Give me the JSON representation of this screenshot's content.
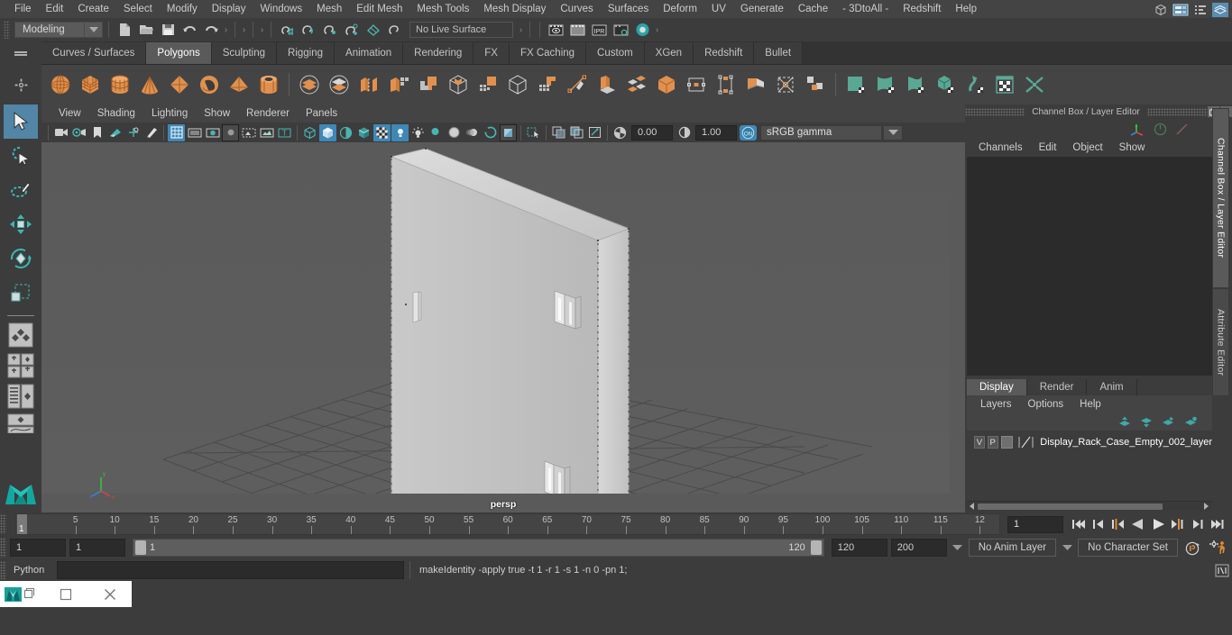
{
  "app": {
    "title": "Autodesk Maya",
    "menubar": [
      "File",
      "Edit",
      "Create",
      "Select",
      "Modify",
      "Display",
      "Windows",
      "Mesh",
      "Edit Mesh",
      "Mesh Tools",
      "Mesh Display",
      "Curves",
      "Surfaces",
      "Deform",
      "UV",
      "Generate",
      "Cache",
      "- 3DtoAll -",
      "Redshift",
      "Help"
    ]
  },
  "status_line": {
    "menu_set": "Modeling",
    "live_surface": "No Live Surface",
    "icons": [
      "new-scene-icon",
      "open-scene-icon",
      "save-scene-icon",
      "undo-icon",
      "redo-icon",
      "select-by-hierarchy-icon",
      "select-by-object-icon",
      "select-by-component-icon",
      "snap-to-grid-icon",
      "snap-to-curve-icon",
      "snap-to-point-icon",
      "snap-to-projected-center-icon",
      "snap-to-view-plane-icon",
      "make-live-icon",
      "render-current-frame-icon",
      "ipr-render-icon",
      "render-settings-icon",
      "hypershade-icon"
    ],
    "right_icons": [
      "show-hide-modeling-toolkit-icon",
      "show-hide-attribute-editor-icon",
      "show-hide-tool-settings-icon",
      "show-hide-channel-box-icon"
    ]
  },
  "shelf": {
    "tabs": [
      "Curves / Surfaces",
      "Polygons",
      "Sculpting",
      "Rigging",
      "Animation",
      "Rendering",
      "FX",
      "FX Caching",
      "Custom",
      "XGen",
      "Redshift",
      "Bullet"
    ],
    "active_tab": "Polygons",
    "icons": [
      "poly-sphere",
      "poly-cube",
      "poly-cylinder",
      "poly-cone",
      "poly-octahedron",
      "poly-torus",
      "poly-pyramid",
      "poly-pipe",
      "combine",
      "separate",
      "extract",
      "booleans-union",
      "booleans-difference",
      "smooth",
      "add-divisions",
      "create-polygon-tool",
      "extrude",
      "bevel",
      "bridge",
      "append-to-polygon",
      "wedge",
      "poke-face",
      "connect-components",
      "multi-cut",
      "target-weld",
      "quad-draw",
      "uv-planar",
      "uv-cylindrical",
      "uv-spherical",
      "uv-automatic",
      "uv-editor",
      "unfold-uv"
    ]
  },
  "toolbox": {
    "tools": [
      "select-tool",
      "lasso-select-tool",
      "paint-select-tool",
      "move-tool",
      "rotate-tool",
      "scale-tool",
      "last-tool-used"
    ],
    "active": "select-tool",
    "layouts": [
      "single-perspective-view",
      "four-view",
      "outliner-persp-view",
      "hypergraph-persp-view",
      "persp-graph-editor"
    ]
  },
  "viewport": {
    "menus": [
      "View",
      "Shading",
      "Lighting",
      "Show",
      "Renderer",
      "Panels"
    ],
    "camera_label": "persp",
    "exposure_value": "0.00",
    "gamma_value": "1.00",
    "color_management": "sRGB gamma",
    "toolbar_icons": [
      "select-camera-icon",
      "camera-attributes-icon",
      "bookmark-icon",
      "image-plane-icon",
      "two-d-pan-zoom-icon",
      "grease-pencil-icon",
      "grid-icon",
      "film-gate-icon",
      "resolution-gate-icon",
      "gate-mask-icon",
      "film-origin-icon",
      "safe-action-icon",
      "title-safe-icon",
      "wireframe-icon",
      "smooth-shade-all-icon",
      "shaded-wireframe-icon",
      "flat-shade-icon",
      "textured-icon",
      "use-default-lighting-icon",
      "use-all-lights-icon",
      "shadows-icon",
      "screen-space-ambient-occlusion-icon",
      "motion-blur-icon",
      "multisample-antialiasing-icon",
      "depth-of-field-icon",
      "isolate-select-icon",
      "xray-icon",
      "xray-joints-icon",
      "xray-active-components-icon",
      "exposure-icon",
      "gamma-icon",
      "color-management-toggle-icon"
    ],
    "model": {
      "object": "Display_Rack_Case_Empty_002",
      "description": "white rectangular display case with door handle and two hinges on the right edge, sitting on a grid floor"
    }
  },
  "right_panel": {
    "window_title": "Channel Box / Layer Editor",
    "channel_menus": [
      "Channels",
      "Edit",
      "Object",
      "Show"
    ],
    "side_tabs": [
      "Channel Box / Layer Editor",
      "Attribute Editor"
    ],
    "active_side_tab": "Channel Box / Layer Editor",
    "layer_tabs": [
      "Display",
      "Render",
      "Anim"
    ],
    "active_layer_tab": "Display",
    "layer_menus": [
      "Layers",
      "Options",
      "Help"
    ],
    "layers": [
      {
        "visibility": "V",
        "playback": "P",
        "type": "",
        "name": "Display_Rack_Case_Empty_002_layer"
      }
    ],
    "layer_buttons": [
      "move-layer-up-icon",
      "move-layer-down-icon",
      "create-new-layer-icon",
      "create-layer-from-selected-icon"
    ]
  },
  "timeline": {
    "tick_labels": [
      "5",
      "10",
      "15",
      "20",
      "25",
      "30",
      "35",
      "40",
      "45",
      "50",
      "55",
      "60",
      "65",
      "70",
      "75",
      "80",
      "85",
      "90",
      "95",
      "100",
      "105",
      "110",
      "115",
      "12"
    ],
    "current_frame_marker": "1",
    "current_frame_field": "1",
    "playback_buttons": [
      "go-to-start-icon",
      "step-back-keyframe-icon",
      "step-back-frame-icon",
      "play-backwards-icon",
      "play-forwards-icon",
      "step-forward-frame-icon",
      "step-forward-keyframe-icon",
      "go-to-end-icon"
    ]
  },
  "range_bar": {
    "anim_start": "1",
    "range_start_field": "1",
    "range_start": "1",
    "range_end": "120",
    "playback_end": "120",
    "anim_end": "200",
    "anim_layer": "No Anim Layer",
    "character_set": "No Character Set",
    "right_icons": [
      "auto-keyframe-icon",
      "animation-preferences-icon"
    ]
  },
  "command_line": {
    "language": "Python",
    "input_value": "",
    "result": "makeIdentity -apply true -t 1 -r 1 -s 1 -n 0 -pn 1;",
    "script_editor_icon": "script-editor-icon"
  },
  "taskbar": {
    "items": [
      "maya-app-icon",
      "restore-window-icon",
      "minimize-window-icon",
      "close-window-icon"
    ]
  },
  "colors": {
    "accent_blue": "#3f87b5",
    "shelf_orange": "#e08b43",
    "teal": "#4cb6b0",
    "panel_bg": "#3c3c3c",
    "viewport_bg": "#5a5a5a",
    "selected_tab": "#5a5a5a"
  }
}
